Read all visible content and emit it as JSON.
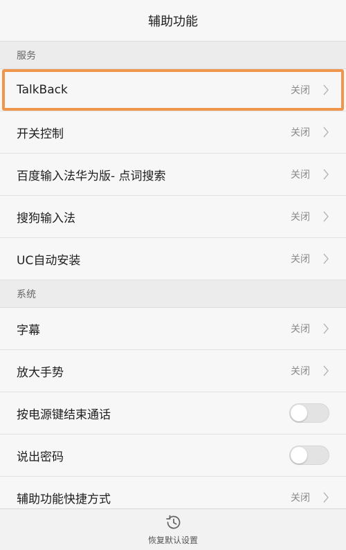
{
  "header": {
    "title": "辅助功能"
  },
  "sections": {
    "services": {
      "title": "服务",
      "items": [
        {
          "label": "TalkBack",
          "value": "关闭"
        },
        {
          "label": "开关控制",
          "value": "关闭"
        },
        {
          "label": "百度输入法华为版- 点词搜索",
          "value": "关闭"
        },
        {
          "label": "搜狗输入法",
          "value": "关闭"
        },
        {
          "label": "UC自动安装",
          "value": "关闭"
        }
      ]
    },
    "system": {
      "title": "系统",
      "items": [
        {
          "label": "字幕",
          "value": "关闭"
        },
        {
          "label": "放大手势",
          "value": "关闭"
        },
        {
          "label": "按电源键结束通话",
          "toggle": false
        },
        {
          "label": "说出密码",
          "toggle": false
        },
        {
          "label": "辅助功能快捷方式",
          "value": "关闭"
        }
      ]
    }
  },
  "footer": {
    "restore_label": "恢复默认设置",
    "icon": "restore-history-icon"
  },
  "colors": {
    "highlight": "#f0954c",
    "background": "#f5f5f5"
  }
}
